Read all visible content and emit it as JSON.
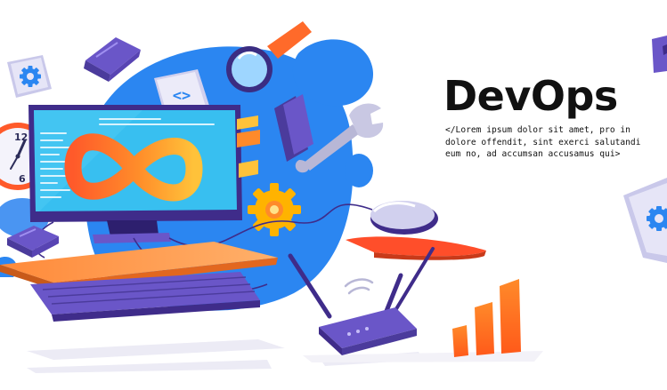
{
  "banner": {
    "title": "DevOps",
    "description": "</Lorem ipsum dolor sit amet, pro in dolore offendit, sint exerci salutandi eum no, ad accumsan accusamus qui>"
  },
  "icons": [
    "gear-icon",
    "code-icon",
    "magnifier-icon",
    "wrench-icon",
    "infinity-icon",
    "clock-icon",
    "mouse-icon",
    "router-icon",
    "bar-chart-icon",
    "keyboard-icon",
    "monitor-icon"
  ],
  "colors": {
    "blob": "#2b86f1",
    "screen": "#38bff0",
    "monitor_frame": "#3f2c8a",
    "orange": "#ff7a1f",
    "gear": "#ffb300",
    "purple": "#7a63d8",
    "headline": "#111111"
  }
}
